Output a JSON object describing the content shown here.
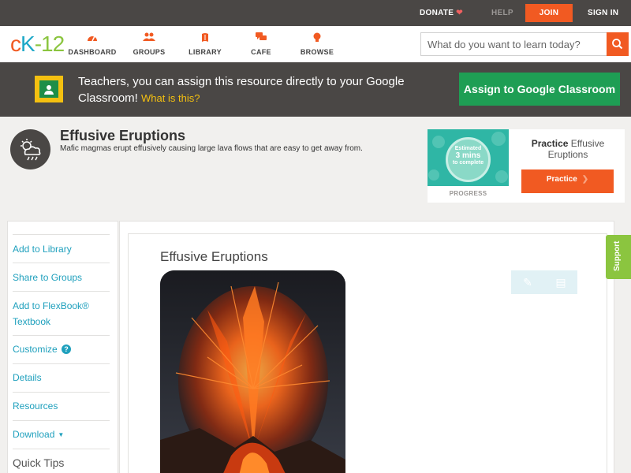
{
  "topbar": {
    "donate_label": "DONATE",
    "help_label": "HELP",
    "join_label": "JOIN",
    "signin_label": "SIGN IN"
  },
  "nav": {
    "logo": {
      "c": "c",
      "k": "K",
      "dash": "-",
      "n": "12"
    },
    "items": [
      {
        "label": "DASHBOARD",
        "icon": "dashboard-gauge-icon"
      },
      {
        "label": "GROUPS",
        "icon": "groups-people-icon"
      },
      {
        "label": "LIBRARY",
        "icon": "library-book-icon"
      },
      {
        "label": "CAFE",
        "icon": "cafe-chat-icon"
      },
      {
        "label": "BROWSE",
        "icon": "browse-lightbulb-icon"
      }
    ],
    "search": {
      "placeholder": "What do you want to learn today?",
      "icon": "search-icon"
    }
  },
  "classroom_banner": {
    "text": "Teachers, you can assign this resource directly to your Google Classroom!",
    "what_is_this": "What is this?",
    "button_label": "Assign to Google Classroom"
  },
  "lesson": {
    "title": "Effusive Eruptions",
    "description": "Mafic magmas erupt effusively causing large lava flows that are easy to get away from.",
    "icon": "weather-cloud-icon"
  },
  "practice_card": {
    "estimate_top": "Estimated",
    "estimate_mins": "3 mins",
    "estimate_bottom": "to complete",
    "progress_label": "PROGRESS",
    "title_bold": "Practice",
    "title_rest": "Effusive Eruptions",
    "button_label": "Practice"
  },
  "sidebar": {
    "items": [
      {
        "label": "Add to Library"
      },
      {
        "label": "Share to Groups"
      },
      {
        "label": "Add to FlexBook® Textbook"
      },
      {
        "label": "Customize"
      },
      {
        "label": "Details"
      },
      {
        "label": "Resources"
      },
      {
        "label": "Download"
      },
      {
        "label": "Quick Tips"
      }
    ]
  },
  "content": {
    "title": "Effusive Eruptions"
  },
  "support_label": "Support",
  "colors": {
    "brand_orange": "#f15a22",
    "brand_teal": "#20a9c8",
    "brand_green": "#8bc53f",
    "classroom_green": "#1e9e54",
    "dark_bar": "#4a4745"
  }
}
